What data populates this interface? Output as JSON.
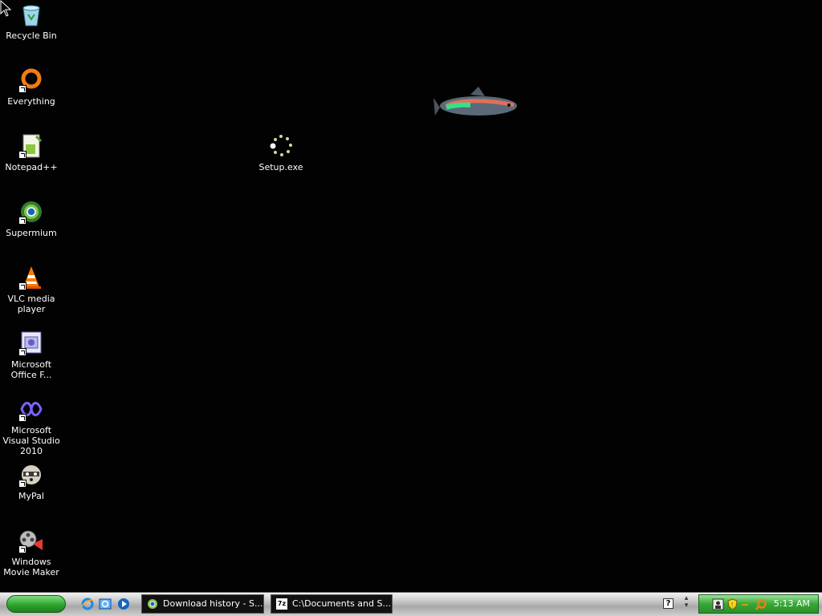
{
  "desktop": {
    "icons": [
      {
        "label": "Recycle Bin"
      },
      {
        "label": "Everything"
      },
      {
        "label": "Notepad++"
      },
      {
        "label": "Supermium"
      },
      {
        "label": "VLC media player"
      },
      {
        "label": "Microsoft Office F..."
      },
      {
        "label": "Microsoft Visual Studio 2010"
      },
      {
        "label": "MyPal"
      },
      {
        "label": "Windows Movie Maker"
      },
      {
        "label": "Setup.exe"
      }
    ]
  },
  "taskbar": {
    "tasks": [
      {
        "label": "Download history - S...",
        "icon": "supermium-icon"
      },
      {
        "label": "C:\\Documents and S...",
        "icon": "7zip-icon"
      }
    ],
    "clock": "5:13 AM",
    "help_glyph": "?",
    "zip_glyph": "7z"
  },
  "colors": {
    "desktop": "#000000",
    "start": "#2ea52e",
    "tray": "#35a835"
  }
}
